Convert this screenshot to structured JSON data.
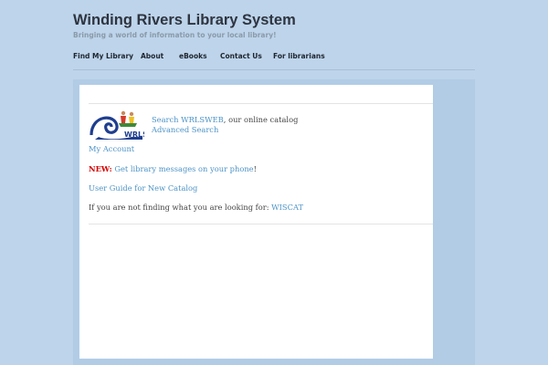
{
  "header": {
    "title": "Winding Rivers Library System",
    "tagline": "Bringing a world of information to your local library!"
  },
  "nav": {
    "items": [
      {
        "label": "Find My Library"
      },
      {
        "label": "About"
      },
      {
        "label": "eBooks"
      },
      {
        "label": "Contact Us"
      },
      {
        "label": "For librarians"
      }
    ]
  },
  "content": {
    "logo_text": "WRLS",
    "search_link": "Search WRLSWEB",
    "search_suffix": ", our online catalog",
    "advanced_search": "Advanced Search",
    "my_account": "My Account",
    "new_label": "NEW:",
    "phone_link": "Get library messages on your phone",
    "phone_suffix": "!",
    "user_guide": "User Guide for New Catalog",
    "not_finding": "If you are not finding what you are looking for: ",
    "wiscat": "WISCAT"
  },
  "colors": {
    "background": "#bdd4ea",
    "link": "#4d93c6",
    "new": "#d40000"
  }
}
